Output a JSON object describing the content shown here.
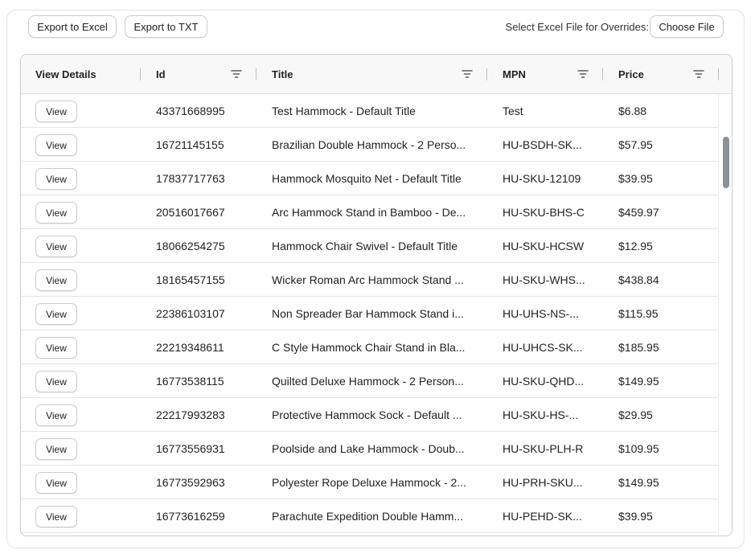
{
  "toolbar": {
    "export_excel": "Export to Excel",
    "export_txt": "Export to TXT",
    "file_label": "Select Excel File for Overrides:",
    "choose_file": "Choose File"
  },
  "table": {
    "columns": [
      "View Details",
      "Id",
      "Title",
      "MPN",
      "Price"
    ],
    "view_label": "View",
    "rows": [
      {
        "id": "43371668995",
        "title": "Test Hammock - Default Title",
        "mpn": "Test",
        "price": "$6.88"
      },
      {
        "id": "16721145155",
        "title": "Brazilian Double Hammock - 2 Perso...",
        "mpn": "HU-BSDH-SK...",
        "price": "$57.95"
      },
      {
        "id": "17837717763",
        "title": "Hammock Mosquito Net - Default Title",
        "mpn": "HU-SKU-12109",
        "price": "$39.95"
      },
      {
        "id": "20516017667",
        "title": "Arc Hammock Stand in Bamboo - De...",
        "mpn": "HU-SKU-BHS-C",
        "price": "$459.97"
      },
      {
        "id": "18066254275",
        "title": "Hammock Chair Swivel - Default Title",
        "mpn": "HU-SKU-HCSW",
        "price": "$12.95"
      },
      {
        "id": "18165457155",
        "title": "Wicker Roman Arc Hammock Stand ...",
        "mpn": "HU-SKU-WHS...",
        "price": "$438.84"
      },
      {
        "id": "22386103107",
        "title": "Non Spreader Bar Hammock Stand i...",
        "mpn": "HU-UHS-NS-...",
        "price": "$115.95"
      },
      {
        "id": "22219348611",
        "title": "C Style Hammock Chair Stand in Bla...",
        "mpn": "HU-UHCS-SK...",
        "price": "$185.95"
      },
      {
        "id": "16773538115",
        "title": "Quilted Deluxe Hammock - 2 Person...",
        "mpn": "HU-SKU-QHD...",
        "price": "$149.95"
      },
      {
        "id": "22217993283",
        "title": "Protective Hammock Sock - Default ...",
        "mpn": "HU-SKU-HS-...",
        "price": "$29.95"
      },
      {
        "id": "16773556931",
        "title": "Poolside and Lake Hammock - Doub...",
        "mpn": "HU-SKU-PLH-R",
        "price": "$109.95"
      },
      {
        "id": "16773592963",
        "title": "Polyester Rope Deluxe Hammock - 2...",
        "mpn": "HU-PRH-SKU...",
        "price": "$149.95"
      },
      {
        "id": "16773616259",
        "title": "Parachute Expedition Double Hamm...",
        "mpn": "HU-PEHD-SK...",
        "price": "$39.95"
      }
    ]
  },
  "icons": {
    "filter": "filter-icon"
  }
}
